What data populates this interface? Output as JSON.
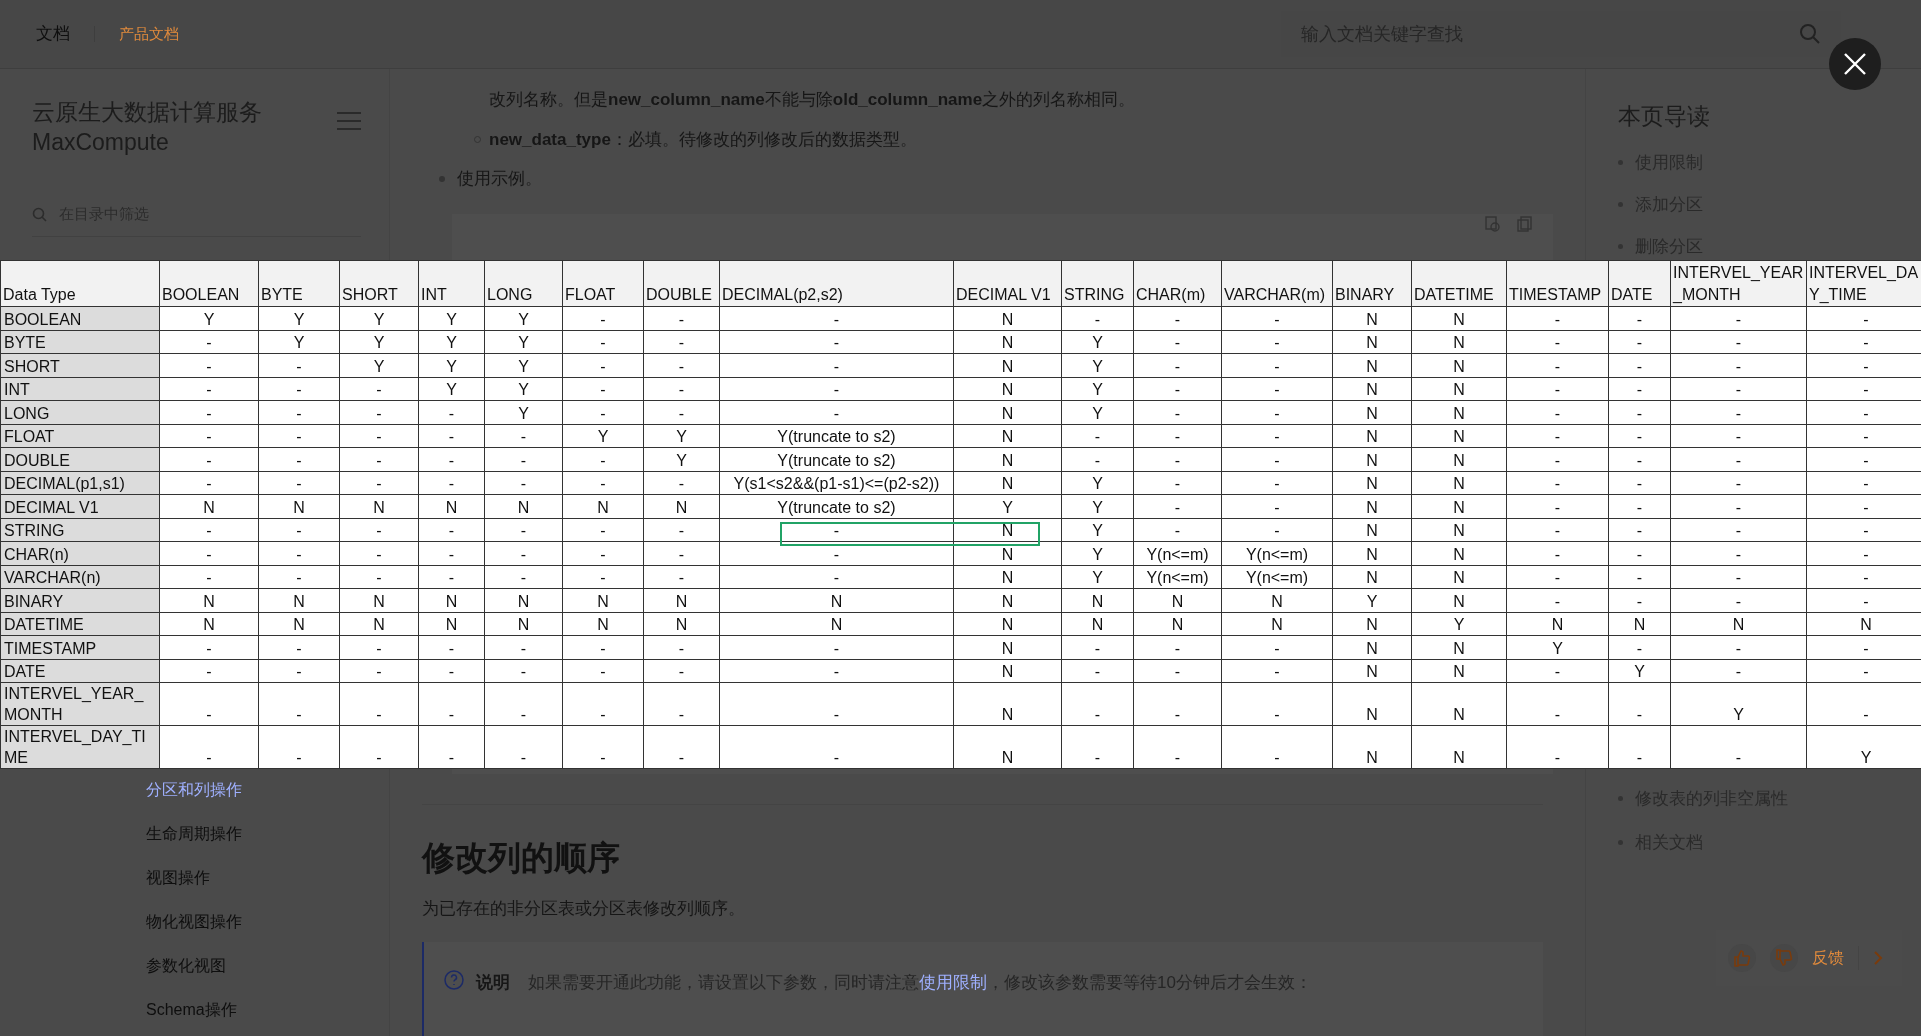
{
  "header": {
    "nav": [
      {
        "label": "文档",
        "selected": false
      },
      {
        "label": "产品文档",
        "selected": true
      }
    ],
    "search": {
      "placeholder": "输入文档关键字查找"
    }
  },
  "sidebar": {
    "title": "云原生大数据计算服务",
    "subtitle": "MaxCompute",
    "filter": {
      "placeholder": "在目录中筛选"
    },
    "items": [
      {
        "label": "分区和列操作",
        "selected": true
      },
      {
        "label": "生命周期操作",
        "selected": false
      },
      {
        "label": "视图操作",
        "selected": false
      },
      {
        "label": "物化视图操作",
        "selected": false
      },
      {
        "label": "参数化视图",
        "selected": false
      },
      {
        "label": "Schema操作",
        "selected": false
      }
    ]
  },
  "content": {
    "items": [
      {
        "kind": "continuation",
        "text": "改列名称。但是**new_column_name**不能与除**old_column_name**之外的列名称相同。"
      },
      {
        "kind": "sub",
        "text": "**new_data_type**：必填。待修改的列修改后的数据类型。"
      },
      {
        "kind": "bullet",
        "text": "使用示例。"
      }
    ],
    "heading": "修改列的顺序",
    "paragraph": "为已存在的非分区表或分区表修改列顺序。",
    "note": {
      "label": "说明",
      "text_before": "如果需要开通此功能，请设置以下参数，同时请注意",
      "link": "使用限制",
      "text_after": "，修改该参数需要等待10分钟后才会生效："
    }
  },
  "toc": {
    "title": "本页导读",
    "items_top": [
      "使用限制",
      "添加分区",
      "删除分区"
    ],
    "items_bottom": [
      "修改表的列非空属性",
      "相关文档"
    ]
  },
  "feedback": {
    "label": "反馈"
  },
  "table_viewer": {
    "columns": [
      "Data Type",
      "BOOLEAN",
      "BYTE",
      "SHORT",
      "INT",
      "LONG",
      "FLOAT",
      "DOUBLE",
      "DECIMAL(p2,s2)",
      "DECIMAL V1",
      "STRING",
      "CHAR(m)",
      "VARCHAR(m)",
      "BINARY",
      "DATETIME",
      "TIMESTAMP",
      "DATE",
      "INTERVEL_YEAR_MONTH",
      "INTERVEL_DAY_TIME"
    ],
    "rows": [
      [
        "BOOLEAN",
        "Y",
        "Y",
        "Y",
        "Y",
        "Y",
        "-",
        "-",
        "-",
        "N",
        "-",
        "-",
        "-",
        "N",
        "N",
        "-",
        "-",
        "-",
        "-"
      ],
      [
        "BYTE",
        "-",
        "Y",
        "Y",
        "Y",
        "Y",
        "-",
        "-",
        "-",
        "N",
        "Y",
        "-",
        "-",
        "N",
        "N",
        "-",
        "-",
        "-",
        "-"
      ],
      [
        "SHORT",
        "-",
        "-",
        "Y",
        "Y",
        "Y",
        "-",
        "-",
        "-",
        "N",
        "Y",
        "-",
        "-",
        "N",
        "N",
        "-",
        "-",
        "-",
        "-"
      ],
      [
        "INT",
        "-",
        "-",
        "-",
        "Y",
        "Y",
        "-",
        "-",
        "-",
        "N",
        "Y",
        "-",
        "-",
        "N",
        "N",
        "-",
        "-",
        "-",
        "-"
      ],
      [
        "LONG",
        "-",
        "-",
        "-",
        "-",
        "Y",
        "-",
        "-",
        "-",
        "N",
        "Y",
        "-",
        "-",
        "N",
        "N",
        "-",
        "-",
        "-",
        "-"
      ],
      [
        "FLOAT",
        "-",
        "-",
        "-",
        "-",
        "-",
        "Y",
        "Y",
        "Y(truncate to s2)",
        "N",
        "-",
        "-",
        "-",
        "N",
        "N",
        "-",
        "-",
        "-",
        "-"
      ],
      [
        "DOUBLE",
        "-",
        "-",
        "-",
        "-",
        "-",
        "-",
        "Y",
        "Y(truncate to s2)",
        "N",
        "-",
        "-",
        "-",
        "N",
        "N",
        "-",
        "-",
        "-",
        "-"
      ],
      [
        "DECIMAL(p1,s1)",
        "-",
        "-",
        "-",
        "-",
        "-",
        "-",
        "-",
        "Y(s1<s2&&(p1-s1)<=(p2-s2))",
        "N",
        "Y",
        "-",
        "-",
        "N",
        "N",
        "-",
        "-",
        "-",
        "-"
      ],
      [
        "DECIMAL V1",
        "N",
        "N",
        "N",
        "N",
        "N",
        "N",
        "N",
        "Y(truncate to s2)",
        "Y",
        "Y",
        "-",
        "-",
        "N",
        "N",
        "-",
        "-",
        "-",
        "-"
      ],
      [
        "STRING",
        "-",
        "-",
        "-",
        "-",
        "-",
        "-",
        "-",
        "-",
        "N",
        "Y",
        "-",
        "-",
        "N",
        "N",
        "-",
        "-",
        "-",
        "-"
      ],
      [
        "CHAR(n)",
        "-",
        "-",
        "-",
        "-",
        "-",
        "-",
        "-",
        "-",
        "N",
        "Y",
        "Y(n<=m)",
        "Y(n<=m)",
        "N",
        "N",
        "-",
        "-",
        "-",
        "-"
      ],
      [
        "VARCHAR(n)",
        "-",
        "-",
        "-",
        "-",
        "-",
        "-",
        "-",
        "-",
        "N",
        "Y",
        "Y(n<=m)",
        "Y(n<=m)",
        "N",
        "N",
        "-",
        "-",
        "-",
        "-"
      ],
      [
        "BINARY",
        "N",
        "N",
        "N",
        "N",
        "N",
        "N",
        "N",
        "N",
        "N",
        "N",
        "N",
        "N",
        "Y",
        "N",
        "-",
        "-",
        "-",
        "-"
      ],
      [
        "DATETIME",
        "N",
        "N",
        "N",
        "N",
        "N",
        "N",
        "N",
        "N",
        "N",
        "N",
        "N",
        "N",
        "N",
        "Y",
        "N",
        "N",
        "N",
        "N"
      ],
      [
        "TIMESTAMP",
        "-",
        "-",
        "-",
        "-",
        "-",
        "-",
        "-",
        "-",
        "N",
        "-",
        "-",
        "-",
        "N",
        "N",
        "Y",
        "-",
        "-",
        "-"
      ],
      [
        "DATE",
        "-",
        "-",
        "-",
        "-",
        "-",
        "-",
        "-",
        "-",
        "N",
        "-",
        "-",
        "-",
        "N",
        "N",
        "-",
        "Y",
        "-",
        "-"
      ],
      [
        "INTERVEL_YEAR_MONTH",
        "-",
        "-",
        "-",
        "-",
        "-",
        "-",
        "-",
        "-",
        "N",
        "-",
        "-",
        "-",
        "N",
        "N",
        "-",
        "-",
        "Y",
        "-"
      ],
      [
        "INTERVEL_DAY_TIME",
        "-",
        "-",
        "-",
        "-",
        "-",
        "-",
        "-",
        "-",
        "N",
        "-",
        "-",
        "-",
        "N",
        "N",
        "-",
        "-",
        "-",
        "Y"
      ]
    ]
  }
}
